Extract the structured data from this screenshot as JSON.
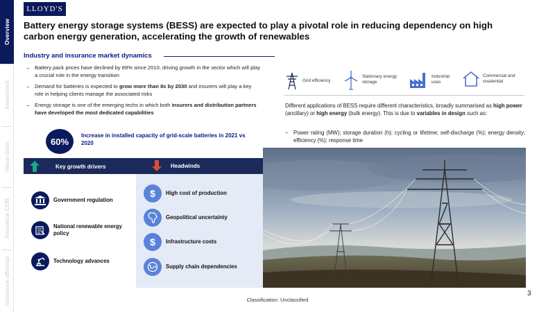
{
  "nav": {
    "tabs": [
      "Overview",
      "Investment",
      "Value chain",
      "Insurance COB",
      "Insurance offerings"
    ]
  },
  "brand": {
    "logo": "LLOYD'S"
  },
  "title": "Battery energy storage systems (BESS) are expected to play a pivotal role in reducing dependency on high carbon energy generation, accelerating the growth of renewables",
  "market": {
    "heading": "Industry and insurance market dynamics",
    "bullet1": "Battery pack prices have declined by 89% since 2010, driving growth in the sector which will play a crucial role in the energy transition",
    "bullet2_pre": "Demand for batteries is expected to ",
    "bullet2_bold": "grow more than 8x by 2030",
    "bullet2_post": " and insurers will play a key role in helping clients manage the associated risks",
    "bullet3_pre": "Energy storage is one of the emerging techs in which both ",
    "bullet3_bold": "insurers and distribution partners have developed the most dedicated capabilities",
    "stat_value": "60%",
    "stat_text": "Increase in installed capacity of grid-scale batteries in 2021 vs 2020"
  },
  "applications": {
    "items": [
      {
        "label": "Grid efficiency",
        "icon": "power-pylon-icon"
      },
      {
        "label": "Stationary energy storage",
        "icon": "wind-turbine-icon"
      },
      {
        "label": "Industrial uses",
        "icon": "factory-icon"
      },
      {
        "label": "Commercial and residential",
        "icon": "house-icon"
      }
    ],
    "desc_1": "Different applications of BESS require different characteristics, broadly summarised as ",
    "desc_b1": "high power",
    "desc_2": " (ancillary) or ",
    "desc_b2": "high energy",
    "desc_3": " (bulk energy). This is due to ",
    "desc_b3": "variables in design",
    "desc_4": " such as:",
    "variables": "Power rating (MW); storage duration (h); cycling or lifetime; self-discharge (%); energy density; efficiency (%); response time"
  },
  "drivers": {
    "heading": "Key growth drivers",
    "items": [
      {
        "label": "Government regulation",
        "icon": "government-building-icon"
      },
      {
        "label": "National renewable energy policy",
        "icon": "policy-document-icon"
      },
      {
        "label": "Technology advances",
        "icon": "robotic-arm-icon"
      }
    ]
  },
  "headwinds": {
    "heading": "Headwinds",
    "items": [
      {
        "label": "High cost of production",
        "icon": "dollar-icon"
      },
      {
        "label": "Geopolitical uncertainty",
        "icon": "africa-map-icon"
      },
      {
        "label": "Infrastructure costs",
        "icon": "dollar-icon"
      },
      {
        "label": "Supply chain dependencies",
        "icon": "globe-icon"
      }
    ]
  },
  "colors": {
    "navy": "#0a1a5c",
    "accent_blue": "#0a1a8a",
    "up_green": "#1aa88a",
    "down_red": "#e04b3a",
    "panel_blue": "#e4eaf6"
  },
  "footer": {
    "classification": "Classification: Unclassified",
    "page": "3"
  }
}
